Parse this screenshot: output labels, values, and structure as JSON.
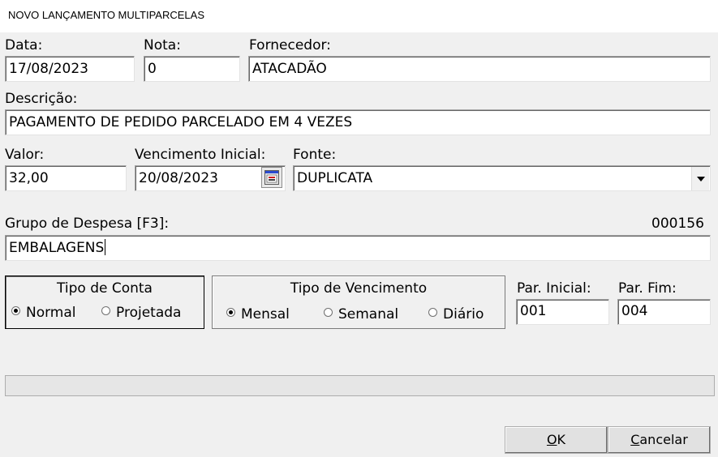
{
  "window": {
    "title": "NOVO LANÇAMENTO MULTIPARCELAS"
  },
  "fields": {
    "data": {
      "label": "Data:",
      "value": "17/08/2023"
    },
    "nota": {
      "label": "Nota:",
      "value": "0"
    },
    "fornecedor": {
      "label": "Fornecedor:",
      "value": "ATACADÃO"
    },
    "descricao": {
      "label": "Descrição:",
      "value": "PAGAMENTO DE PEDIDO PARCELADO EM 4 VEZES"
    },
    "valor": {
      "label": "Valor:",
      "value": "32,00"
    },
    "vencimento": {
      "label": "Vencimento Inicial:",
      "value": "20/08/2023"
    },
    "fonte": {
      "label": "Fonte:",
      "value": "DUPLICATA"
    },
    "grupo": {
      "label": "Grupo de Despesa [F3]:",
      "code": "000156",
      "value": "EMBALAGENS"
    },
    "par_inicial": {
      "label": "Par. Inicial:",
      "value": "001"
    },
    "par_fim": {
      "label": "Par. Fim:",
      "value": "004"
    }
  },
  "tipo_conta": {
    "title": "Tipo de Conta",
    "options": [
      "Normal",
      "Projetada"
    ],
    "selected": "Normal"
  },
  "tipo_vencimento": {
    "title": "Tipo de Vencimento",
    "options": [
      "Mensal",
      "Semanal",
      "Diário"
    ],
    "selected": "Mensal"
  },
  "buttons": {
    "ok": {
      "mnemonic": "O",
      "rest": "K"
    },
    "cancelar": {
      "mnemonic": "C",
      "rest": "ancelar"
    }
  },
  "icons": {
    "calendar": "calendar-icon",
    "dropdown": "chevron-down-icon"
  }
}
